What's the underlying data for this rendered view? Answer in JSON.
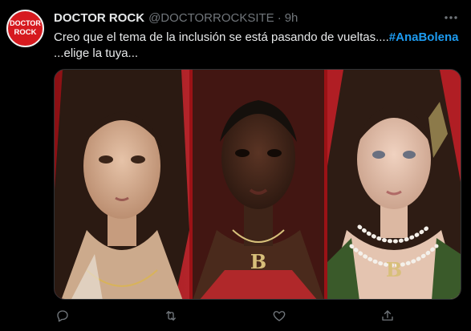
{
  "tweet": {
    "author": {
      "name": "DOCTOR ROCK",
      "handle": "@DOCTORROCKSITE",
      "avatar_line1": "DOCTOR",
      "avatar_line2": "ROCK"
    },
    "separator": "·",
    "time": "9h",
    "text_line1": "Creo que el tema de la inclusión se está pasando de vueltas....",
    "hashtag": "#AnaBolena",
    "text_line2": "...elige la tuya...",
    "icons": {
      "more": "more-options-icon",
      "reply": "reply-icon",
      "retweet": "retweet-icon",
      "like": "like-icon",
      "share": "share-icon"
    }
  },
  "colors": {
    "background": "#000000",
    "text": "#e7e9ea",
    "secondary": "#71767b",
    "link": "#1d9bf0",
    "avatar_bg": "#d61a1f",
    "frame_red": "#9b1216"
  }
}
